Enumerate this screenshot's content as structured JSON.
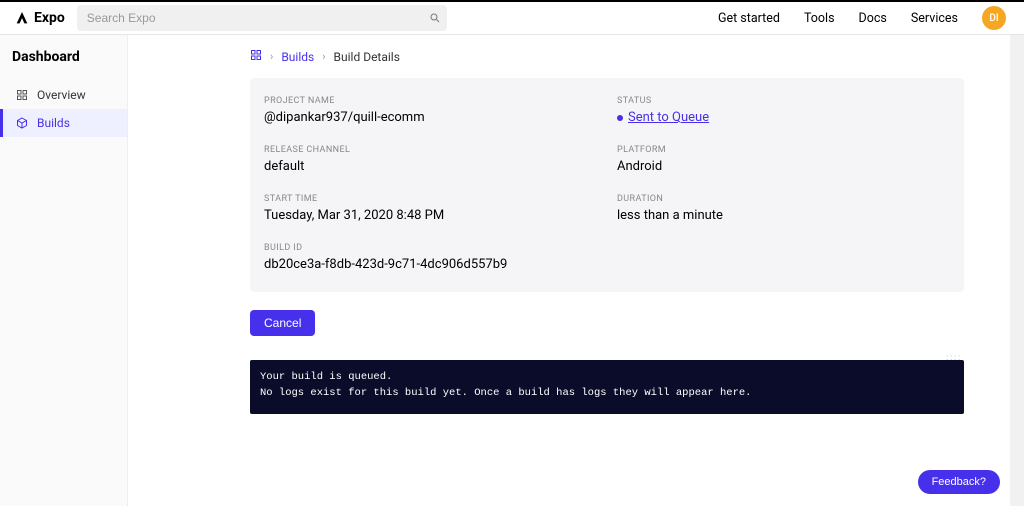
{
  "header": {
    "logo_text": "Expo",
    "search_placeholder": "Search Expo",
    "nav": {
      "get_started": "Get started",
      "tools": "Tools",
      "docs": "Docs",
      "services": "Services"
    },
    "avatar_initials": "DI"
  },
  "sidebar": {
    "title": "Dashboard",
    "items": [
      {
        "label": "Overview"
      },
      {
        "label": "Builds"
      }
    ]
  },
  "breadcrumbs": {
    "builds": "Builds",
    "current": "Build Details"
  },
  "build": {
    "project_name_label": "PROJECT NAME",
    "project_name": "@dipankar937/quill-ecomm",
    "status_label": "STATUS",
    "status_text": "Sent to Queue",
    "release_channel_label": "RELEASE CHANNEL",
    "release_channel": "default",
    "platform_label": "PLATFORM",
    "platform": "Android",
    "start_time_label": "START TIME",
    "start_time": "Tuesday, Mar 31, 2020 8:48 PM",
    "duration_label": "DURATION",
    "duration": "less than a minute",
    "build_id_label": "BUILD ID",
    "build_id": "db20ce3a-f8db-423d-9c71-4dc906d557b9"
  },
  "actions": {
    "cancel": "Cancel"
  },
  "logs": {
    "line1": "Your build is queued.",
    "line2": "No logs exist for this build yet. Once a build has logs they will appear here."
  },
  "feedback": "Feedback?"
}
